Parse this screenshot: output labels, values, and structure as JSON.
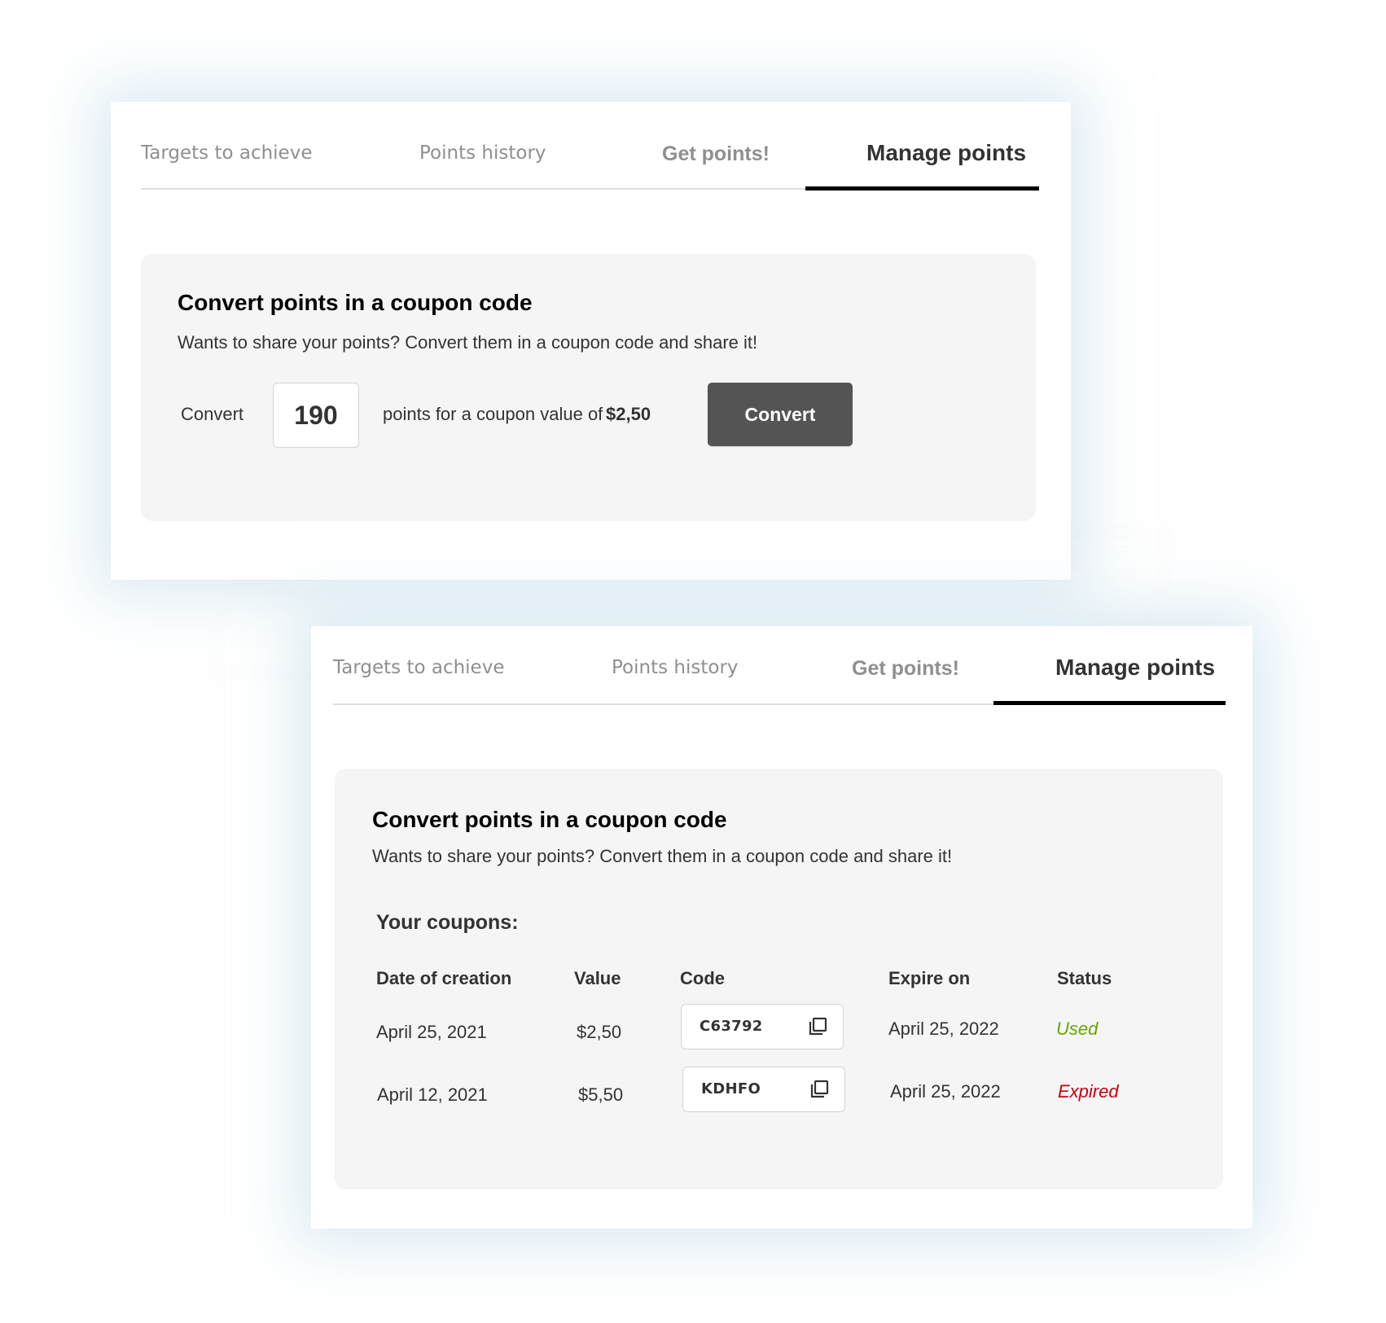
{
  "tabs": [
    {
      "label": "Targets to achieve",
      "active": false
    },
    {
      "label": "Points history",
      "active": false
    },
    {
      "label": "Get points!",
      "active": false
    },
    {
      "label": "Manage points",
      "active": true
    }
  ],
  "convert_section": {
    "title": "Convert points in a coupon code",
    "subtitle": "Wants to share your points? Convert them in a coupon code and share it!"
  },
  "convert_form": {
    "label": "Convert",
    "points_value": "190",
    "points_text": "points for a coupon value of",
    "coupon_value": "$2,50",
    "button_label": "Convert"
  },
  "coupons": {
    "title": "Your coupons:",
    "columns": [
      "Date of creation",
      "Value",
      "Code",
      "Expire on",
      "Status"
    ],
    "rows": [
      {
        "date": "April 25, 2021",
        "value": "$2,50",
        "code": "C63792",
        "expire": "April 25, 2022",
        "status": "Used",
        "status_color": "#6aa400",
        "copy_icon": "copy-icon"
      },
      {
        "date": "April 12, 2021",
        "value": "$5,50",
        "code": "KDHFO",
        "expire": "April 25, 2022",
        "status": "Expired",
        "status_color": "#c8000f",
        "copy_icon": "copy-icon"
      }
    ]
  },
  "colors": {
    "active_tab_underline": "#000000",
    "button_bg": "#545454",
    "panel_bg": "#f5f5f5",
    "used_status": "#6aa400",
    "expired_status": "#c8000f"
  }
}
